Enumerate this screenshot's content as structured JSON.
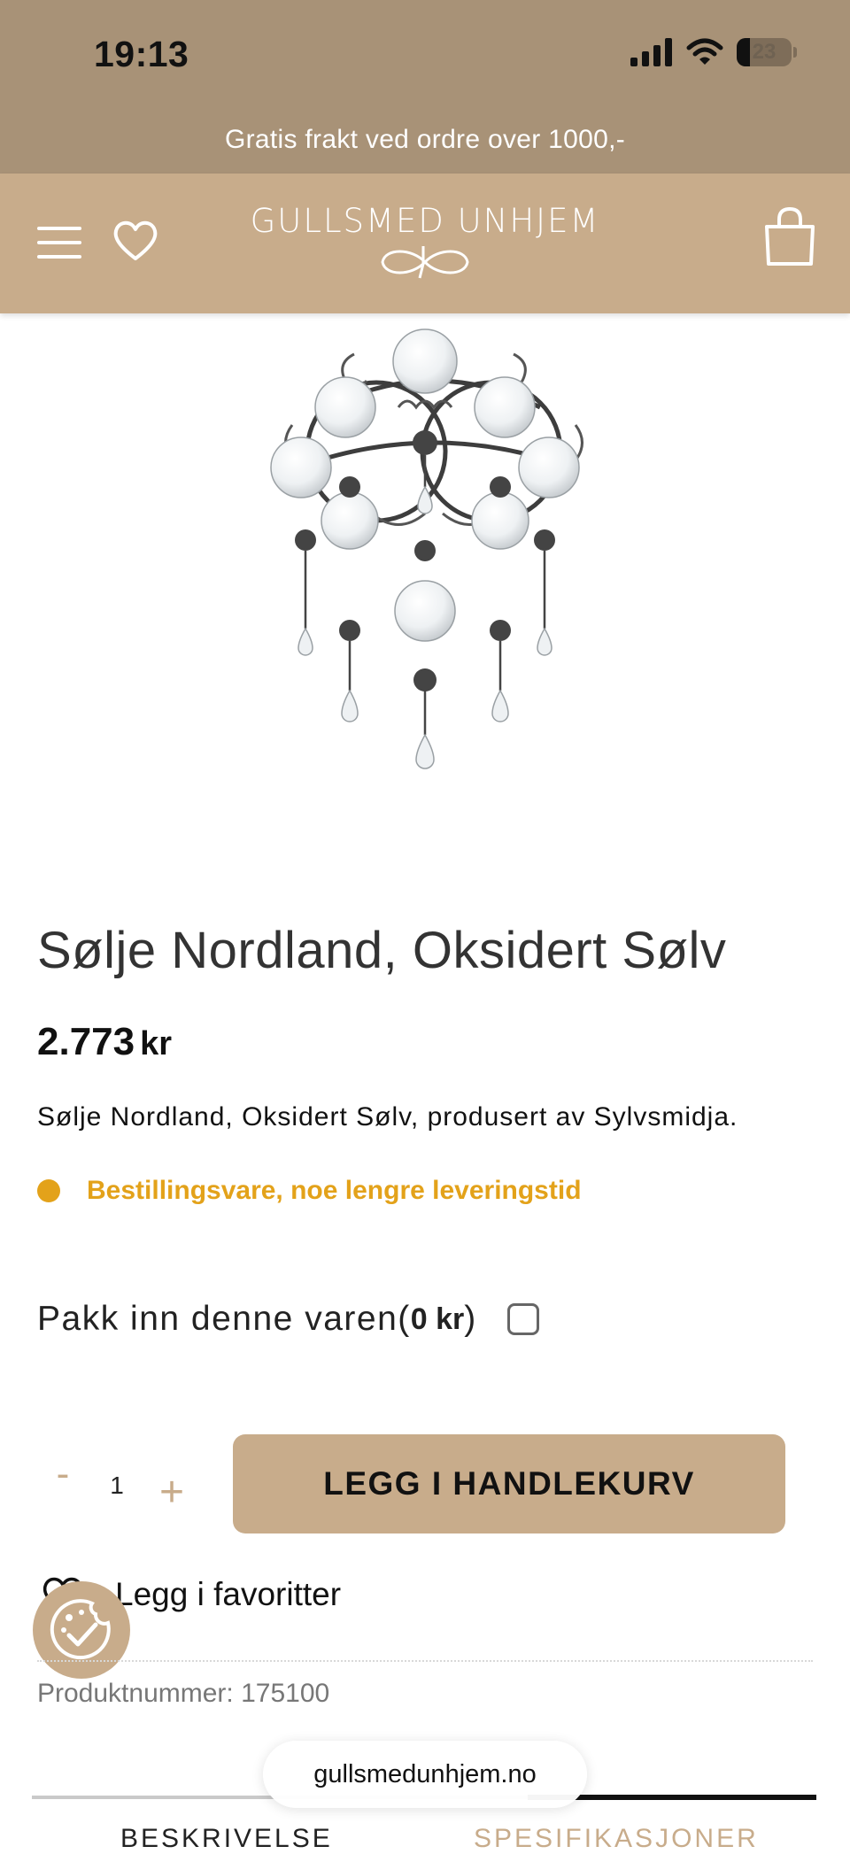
{
  "status_bar": {
    "time": "19:13",
    "battery": "23"
  },
  "promo": {
    "text": "Gratis frakt ved ordre over 1000,-"
  },
  "header": {
    "logo_text": "GULLSMED UNHJEM"
  },
  "product": {
    "title": "Sølje Nordland, Oksidert Sølv",
    "price_amount": "2.773",
    "price_currency": "kr",
    "short_description": "Sølje Nordland, Oksidert Sølv, produsert av Sylvsmidja.",
    "stock_status": "Bestillingsvare, noe lengre leveringstid",
    "product_number": "Produktnummer: 175100"
  },
  "gift_wrap": {
    "label": "Pakk inn denne varen(",
    "price": "0 kr",
    "suffix": ")",
    "checked": false
  },
  "quantity": {
    "minus": "-",
    "value": "1",
    "plus": "+"
  },
  "add_to_cart": {
    "label": "LEGG I HANDLEKURV"
  },
  "favorites": {
    "label": "Legg i favoritter"
  },
  "tabs": [
    {
      "label": "BESKRIVELSE"
    },
    {
      "label": "SPESIFIKASJONER"
    }
  ],
  "browser": {
    "url": "gullsmedunhjem.no"
  },
  "colors": {
    "header": "#c8ac8b",
    "status": "#a89277",
    "stock": "#e3a21a"
  }
}
